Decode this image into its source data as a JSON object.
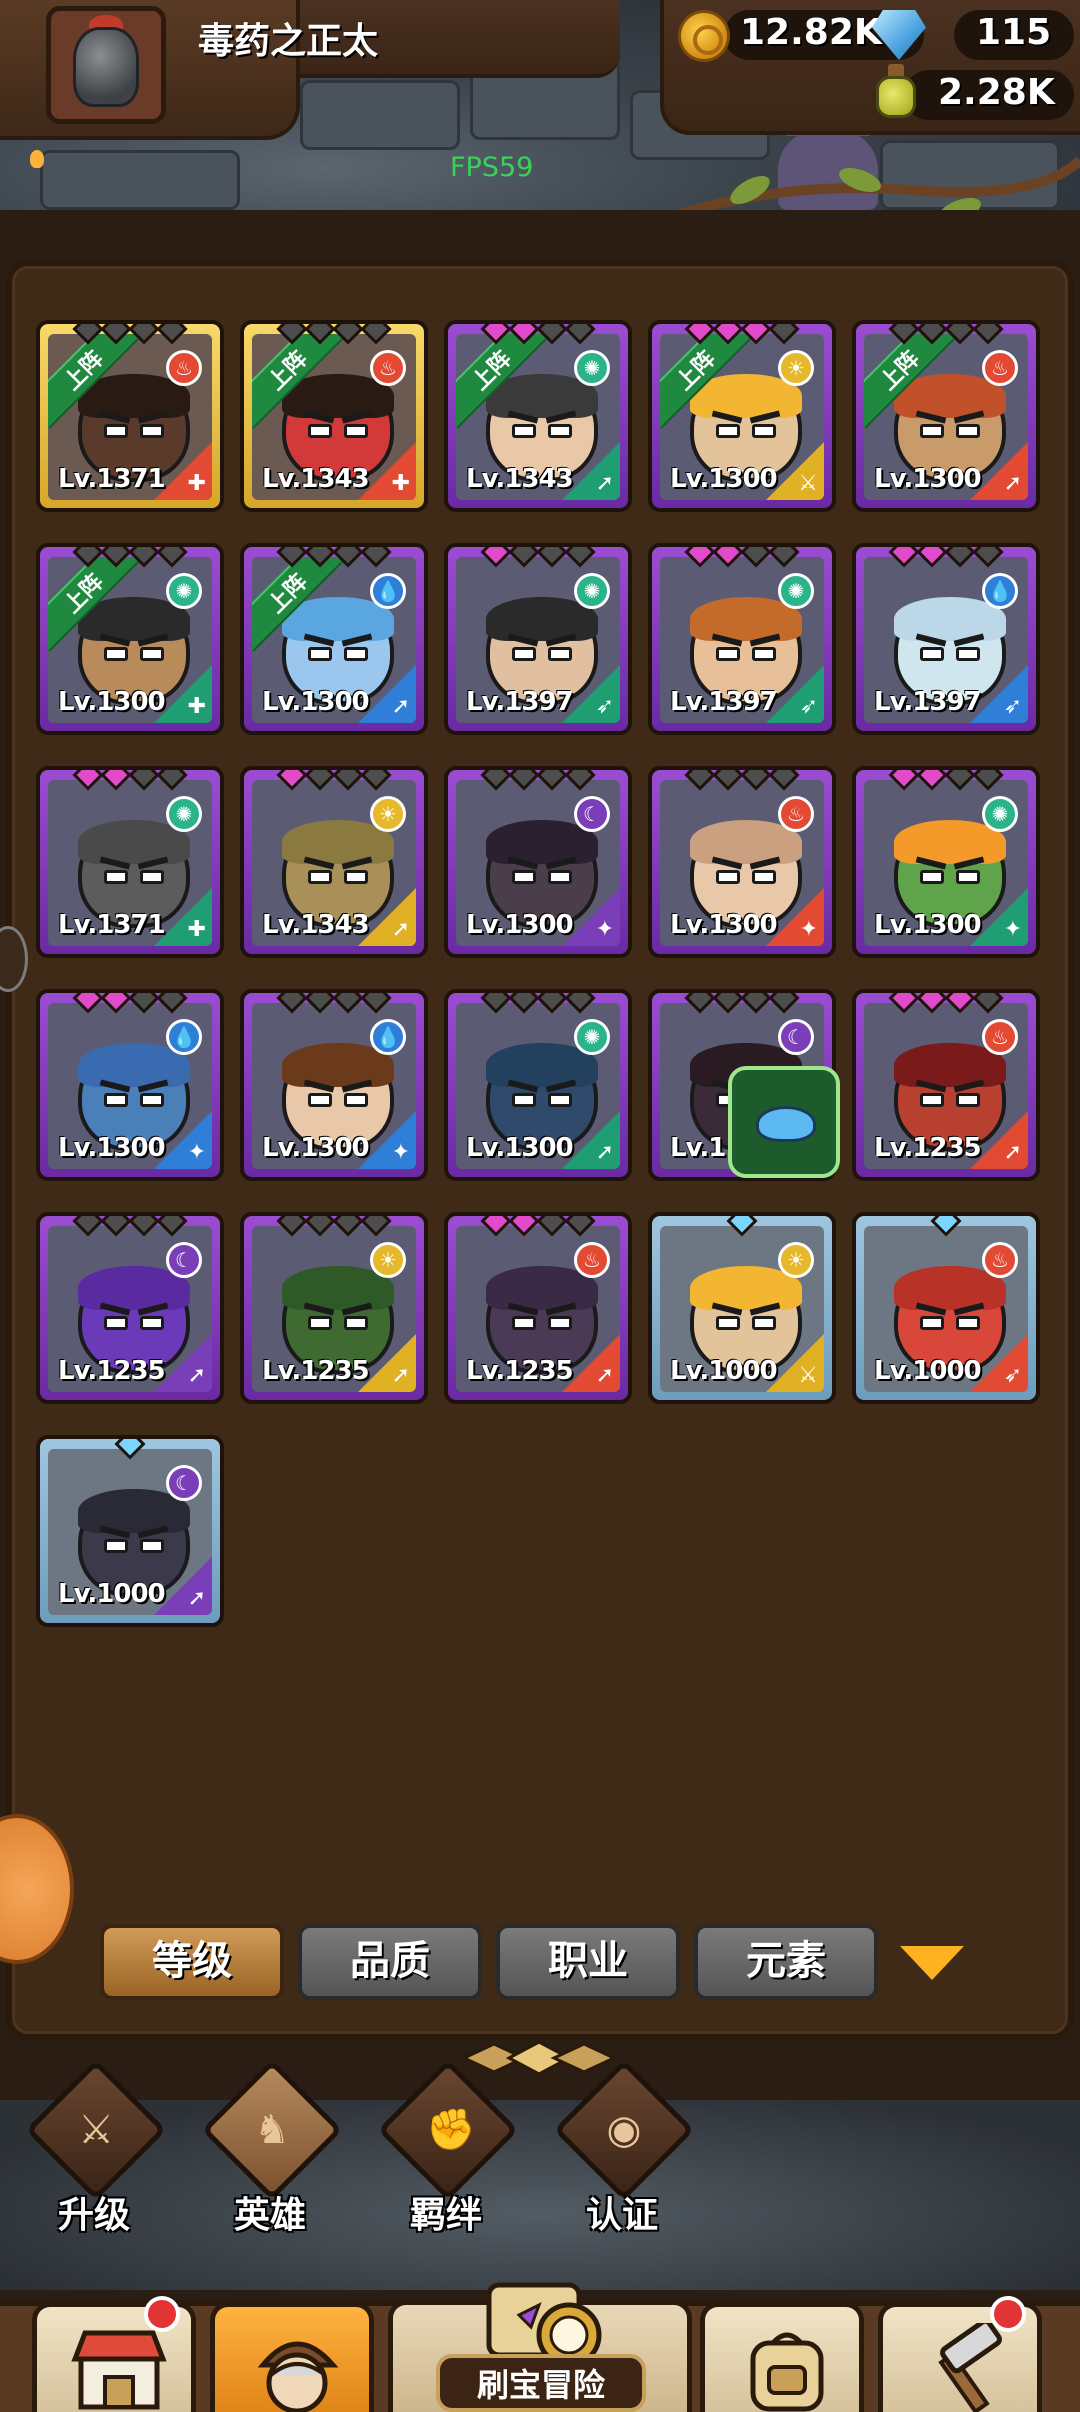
{
  "header": {
    "player_name": "毒药之正太",
    "fps": "FPS59",
    "resources": {
      "gold": "12.82K",
      "gems": "115",
      "potion": "2.28K"
    }
  },
  "heroes": [
    {
      "level": "Lv.1371",
      "quality": "gold",
      "element": "fire",
      "deployed": true,
      "deploy_label": "上阵",
      "stars": [
        0,
        0,
        0,
        0
      ]
    },
    {
      "level": "Lv.1343",
      "quality": "gold",
      "element": "fire",
      "deployed": true,
      "deploy_label": "上阵",
      "stars": [
        0,
        0,
        0,
        0
      ]
    },
    {
      "level": "Lv.1343",
      "quality": "purple",
      "element": "wind",
      "deployed": true,
      "deploy_label": "上阵",
      "stars": [
        1,
        1,
        0,
        0
      ]
    },
    {
      "level": "Lv.1300",
      "quality": "purple",
      "element": "light",
      "deployed": true,
      "deploy_label": "上阵",
      "stars": [
        1,
        1,
        1,
        0
      ]
    },
    {
      "level": "Lv.1300",
      "quality": "purple",
      "element": "fire",
      "deployed": true,
      "deploy_label": "上阵",
      "stars": [
        0,
        0,
        0,
        0
      ]
    },
    {
      "level": "Lv.1300",
      "quality": "purple",
      "element": "wind",
      "deployed": true,
      "deploy_label": "上阵",
      "stars": [
        0,
        0,
        0,
        0
      ]
    },
    {
      "level": "Lv.1300",
      "quality": "purple",
      "element": "water",
      "deployed": true,
      "deploy_label": "上阵",
      "stars": [
        0,
        0,
        0,
        0
      ]
    },
    {
      "level": "Lv.1397",
      "quality": "purple",
      "element": "wind",
      "deployed": false,
      "stars": [
        1,
        0,
        0,
        0
      ]
    },
    {
      "level": "Lv.1397",
      "quality": "purple",
      "element": "wind",
      "deployed": false,
      "stars": [
        1,
        1,
        0,
        0
      ]
    },
    {
      "level": "Lv.1397",
      "quality": "purple",
      "element": "water",
      "deployed": false,
      "stars": [
        1,
        1,
        0,
        0
      ]
    },
    {
      "level": "Lv.1371",
      "quality": "purple",
      "element": "wind",
      "deployed": false,
      "stars": [
        1,
        1,
        0,
        0
      ]
    },
    {
      "level": "Lv.1343",
      "quality": "purple",
      "element": "light",
      "deployed": false,
      "stars": [
        1,
        0,
        0,
        0
      ]
    },
    {
      "level": "Lv.1300",
      "quality": "purple",
      "element": "dark",
      "deployed": false,
      "stars": [
        0,
        0,
        0,
        0
      ]
    },
    {
      "level": "Lv.1300",
      "quality": "purple",
      "element": "fire",
      "deployed": false,
      "stars": [
        0,
        0,
        0,
        0
      ]
    },
    {
      "level": "Lv.1300",
      "quality": "purple",
      "element": "wind",
      "deployed": false,
      "stars": [
        1,
        1,
        0,
        0
      ]
    },
    {
      "level": "Lv.1300",
      "quality": "purple",
      "element": "water",
      "deployed": false,
      "stars": [
        1,
        1,
        0,
        0
      ]
    },
    {
      "level": "Lv.1300",
      "quality": "purple",
      "element": "water",
      "deployed": false,
      "stars": [
        0,
        0,
        0,
        0
      ]
    },
    {
      "level": "Lv.1300",
      "quality": "purple",
      "element": "wind",
      "deployed": false,
      "stars": [
        0,
        0,
        0,
        0
      ]
    },
    {
      "level": "Lv.1",
      "quality": "purple",
      "element": "dark",
      "deployed": false,
      "stars": [
        0,
        0,
        0,
        0
      ]
    },
    {
      "level": "Lv.1235",
      "quality": "purple",
      "element": "fire",
      "deployed": false,
      "stars": [
        1,
        1,
        1,
        0
      ]
    },
    {
      "level": "Lv.1235",
      "quality": "purple",
      "element": "dark",
      "deployed": false,
      "stars": [
        0,
        0,
        0,
        0
      ]
    },
    {
      "level": "Lv.1235",
      "quality": "purple",
      "element": "light",
      "deployed": false,
      "stars": [
        0,
        0,
        0,
        0
      ]
    },
    {
      "level": "Lv.1235",
      "quality": "purple",
      "element": "fire",
      "deployed": false,
      "stars": [
        1,
        1,
        0,
        0
      ]
    },
    {
      "level": "Lv.1000",
      "quality": "blue",
      "element": "light",
      "deployed": false,
      "stars": [
        1
      ]
    },
    {
      "level": "Lv.1000",
      "quality": "blue",
      "element": "fire",
      "deployed": false,
      "stars": [
        1
      ]
    },
    {
      "level": "Lv.1000",
      "quality": "blue",
      "element": "dark",
      "deployed": false,
      "stars": [
        1
      ]
    }
  ],
  "filters": {
    "level": "等级",
    "quality": "品质",
    "class": "职业",
    "element": "元素"
  },
  "categories": {
    "upgrade": "升级",
    "heroes": "英雄",
    "bonds": "羁绊",
    "certify": "认证"
  },
  "bottom_nav": {
    "adventure": "刷宝冒险"
  },
  "colors": {
    "gold_quality": "#f8d96a",
    "purple_quality": "#9b4dd1",
    "blue_quality": "#9fc6df",
    "active_tab": "#d19a58",
    "fps_green": "#3bd15a"
  }
}
